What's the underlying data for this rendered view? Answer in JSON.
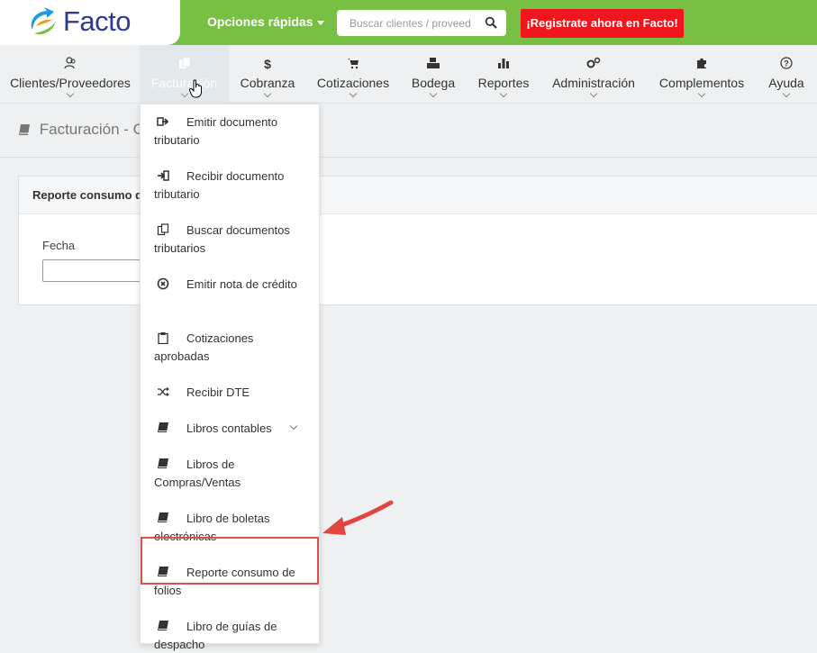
{
  "brand": {
    "name": "Facto"
  },
  "topbar": {
    "quick_options": "Opciones rápidas",
    "search_placeholder": "Buscar clientes / proveed",
    "register_label": "¡Registrate ahora en Facto!"
  },
  "nav": {
    "items": [
      {
        "label": "Clientes/Proveedores",
        "icon": "users-icon"
      },
      {
        "label": "Facturación",
        "icon": "documents-icon"
      },
      {
        "label": "Cobranza",
        "icon": "dollar-icon"
      },
      {
        "label": "Cotizaciones",
        "icon": "cart-icon"
      },
      {
        "label": "Bodega",
        "icon": "cubes-icon"
      },
      {
        "label": "Reportes",
        "icon": "bar-chart-icon"
      },
      {
        "label": "Administración",
        "icon": "gears-icon"
      },
      {
        "label": "Complementos",
        "icon": "puzzle-icon"
      },
      {
        "label": "Ayuda",
        "icon": "help-icon"
      }
    ]
  },
  "page": {
    "title": "Facturación - Co"
  },
  "card": {
    "header": "Reporte consumo d",
    "fecha_label": "Fecha"
  },
  "dropdown": {
    "items": [
      {
        "label": "Emitir documento tributario",
        "icon": "sign-out-icon"
      },
      {
        "label": "Recibir documento tributario",
        "icon": "sign-in-icon"
      },
      {
        "label": "Buscar documentos tributarios",
        "icon": "copy-icon"
      },
      {
        "label": "Emitir nota de crédito",
        "icon": "times-circle-icon"
      },
      {
        "label": "Cotizaciones aprobadas",
        "icon": "clipboard-icon"
      },
      {
        "label": "Recibir DTE",
        "icon": "random-icon"
      },
      {
        "label": "Libros contables",
        "icon": "book-icon"
      },
      {
        "label": "Libros de Compras/Ventas",
        "icon": "book-icon"
      },
      {
        "label": "Libro de boletas electrónicas",
        "icon": "book-icon"
      },
      {
        "label": "Reporte consumo de folios",
        "icon": "book-icon"
      },
      {
        "label": "Libro de guías de despacho",
        "icon": "book-icon"
      }
    ]
  },
  "colors": {
    "topbar": "#77c043",
    "register": "#f3151d",
    "brand_text": "#2f3b8c",
    "highlight": "#d9504c"
  }
}
